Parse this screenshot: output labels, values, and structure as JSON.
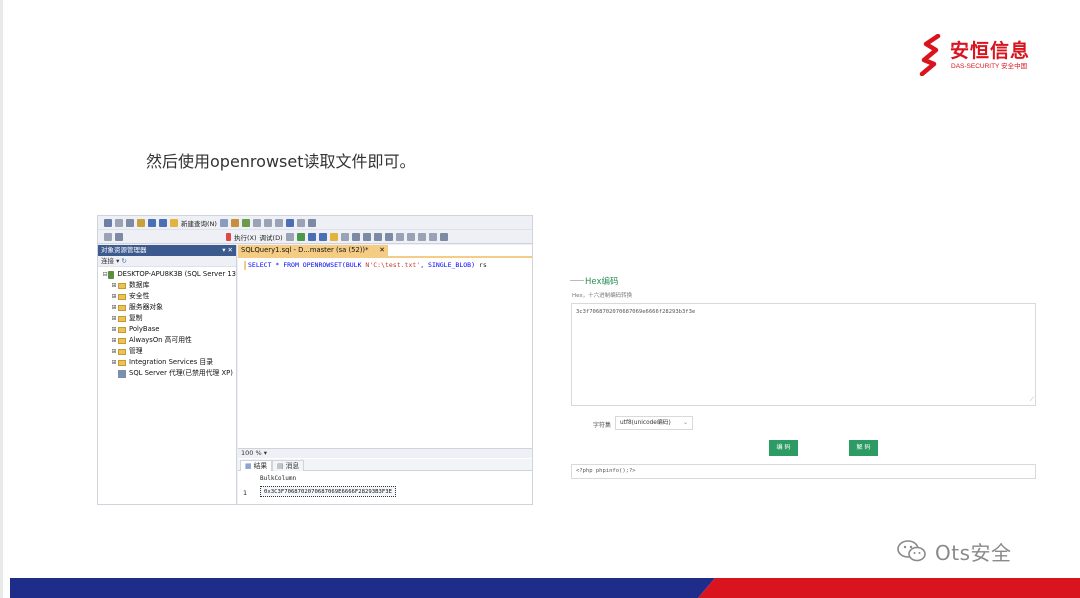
{
  "brand": {
    "name": "安恒信息",
    "sub": "DAS-SECURITY 安全中国",
    "color": "#d9141f"
  },
  "headline": "然后使用openrowset读取文件即可。",
  "ssms": {
    "toolbar": {
      "new_query": "新建查询(N)",
      "database": "master",
      "execute": "执行(X)",
      "debug": "调试(D)"
    },
    "object_explorer": {
      "title": "对象资源管理器",
      "connect": "连接 ▾",
      "tree": [
        {
          "label": "DESKTOP-APU8K3B (SQL Server 13",
          "type": "server",
          "expander": "⊟"
        },
        {
          "label": "数据库",
          "type": "folder",
          "expander": "⊞"
        },
        {
          "label": "安全性",
          "type": "folder",
          "expander": "⊞"
        },
        {
          "label": "服务器对象",
          "type": "folder",
          "expander": "⊞"
        },
        {
          "label": "复制",
          "type": "folder",
          "expander": "⊞"
        },
        {
          "label": "PolyBase",
          "type": "folder",
          "expander": "⊞"
        },
        {
          "label": "AlwaysOn 高可用性",
          "type": "folder",
          "expander": "⊞"
        },
        {
          "label": "管理",
          "type": "folder",
          "expander": "⊞"
        },
        {
          "label": "Integration Services 目录",
          "type": "folder",
          "expander": "⊞"
        },
        {
          "label": "SQL Server 代理(已禁用代理 XP)",
          "type": "agent",
          "expander": ""
        }
      ]
    },
    "editor": {
      "tab_label": "SQLQuery1.sql - D...master (sa (52))*",
      "code_kw1": "SELECT * FROM OPENROWSET(BULK ",
      "code_str": "N'C:\\test.txt'",
      "code_kw2": ", SINGLE_BLOB)",
      "code_alias": " rs",
      "zoom": "100 %",
      "results_tab": "结果",
      "messages_tab": "消息",
      "column_header": "BulkColumn",
      "row_number": "1",
      "cell_value": "0x3C3F7068702070687069E6666F28293B3F3E"
    }
  },
  "hex_tool": {
    "title": "Hex编码",
    "description": "Hex，十六进制编码转换",
    "input_value": "3c3f7068702070687069e6666f28293b3f3e",
    "charset_label": "字符集",
    "charset_value": "utf8(unicode编码)",
    "encode_label": "编 码",
    "decode_label": "解 码",
    "output_value": "<?php phpinfo();?>",
    "accent": "#2c9b64"
  },
  "watermark": {
    "text": "Ots安全"
  },
  "footer_colors": {
    "navy": "#1f2d8a",
    "red": "#d9141f"
  }
}
